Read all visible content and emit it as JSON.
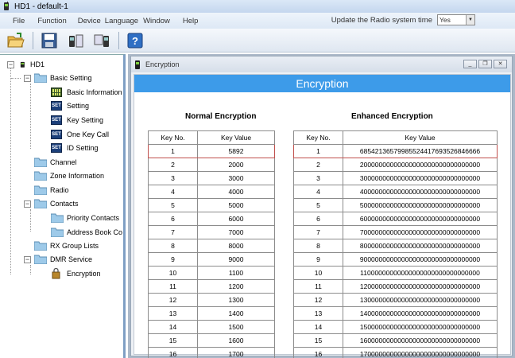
{
  "window": {
    "title": "HD1  -  default-1"
  },
  "menu": {
    "items": [
      "File",
      "Function",
      "Device",
      "Language",
      "Window",
      "Help"
    ],
    "update_label": "Update the Radio system time",
    "update_value": "Yes"
  },
  "toolbar": {
    "buttons": [
      "open-icon",
      "save-icon",
      "read-radio-icon",
      "write-radio-icon",
      "help-icon"
    ]
  },
  "tree": {
    "root": "HD1",
    "basic_setting": "Basic Setting",
    "basic_information": "Basic Information",
    "setting": "Setting",
    "key_setting": "Key Setting",
    "one_key_call": "One Key Call",
    "id_setting": "ID Setting",
    "channel": "Channel",
    "zone_information": "Zone Information",
    "radio": "Radio",
    "contacts": "Contacts",
    "priority_contacts": "Priority Contacts",
    "address_book": "Address Book Co",
    "rx_group_lists": "RX Group Lists",
    "dmr_service": "DMR Service",
    "encryption": "Encryption",
    "set_badge": "SET"
  },
  "child_window": {
    "title": "Encryption",
    "banner": "Encryption"
  },
  "normal": {
    "title": "Normal Encryption",
    "col_key_no": "Key No.",
    "col_key_value": "Key Value",
    "rows": [
      [
        "1",
        "5892"
      ],
      [
        "2",
        "2000"
      ],
      [
        "3",
        "3000"
      ],
      [
        "4",
        "4000"
      ],
      [
        "5",
        "5000"
      ],
      [
        "6",
        "6000"
      ],
      [
        "7",
        "7000"
      ],
      [
        "8",
        "8000"
      ],
      [
        "9",
        "9000"
      ],
      [
        "10",
        "1100"
      ],
      [
        "11",
        "1200"
      ],
      [
        "12",
        "1300"
      ],
      [
        "13",
        "1400"
      ],
      [
        "14",
        "1500"
      ],
      [
        "15",
        "1600"
      ],
      [
        "16",
        "1700"
      ]
    ]
  },
  "enhanced": {
    "title": "Enhanced Encryption",
    "col_key_no": "Key No.",
    "col_key_value": "Key Value",
    "rows": [
      [
        "1",
        "68542136579985524417693526846666"
      ],
      [
        "2",
        "20000000000000000000000000000000"
      ],
      [
        "3",
        "30000000000000000000000000000000"
      ],
      [
        "4",
        "40000000000000000000000000000000"
      ],
      [
        "5",
        "50000000000000000000000000000000"
      ],
      [
        "6",
        "60000000000000000000000000000000"
      ],
      [
        "7",
        "70000000000000000000000000000000"
      ],
      [
        "8",
        "80000000000000000000000000000000"
      ],
      [
        "9",
        "90000000000000000000000000000000"
      ],
      [
        "10",
        "11000000000000000000000000000000"
      ],
      [
        "11",
        "12000000000000000000000000000000"
      ],
      [
        "12",
        "13000000000000000000000000000000"
      ],
      [
        "13",
        "14000000000000000000000000000000"
      ],
      [
        "14",
        "15000000000000000000000000000000"
      ],
      [
        "15",
        "16000000000000000000000000000000"
      ],
      [
        "16",
        "17000000000000000000000000000000"
      ]
    ]
  },
  "colors": {
    "banner": "#3d9be9",
    "highlight": "#c0504d",
    "mdi_bg": "#abb8c8"
  }
}
